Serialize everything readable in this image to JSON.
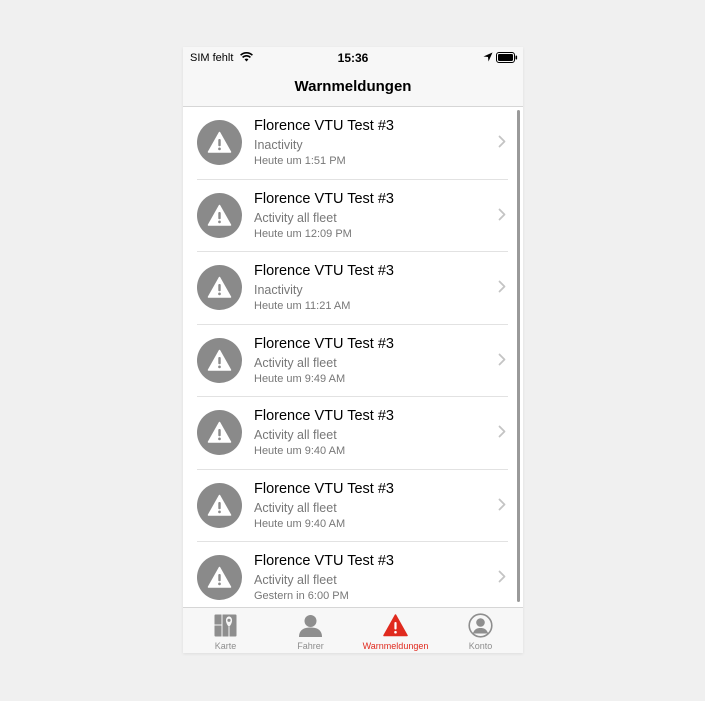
{
  "status": {
    "carrier": "SIM fehlt",
    "time": "15:36"
  },
  "nav": {
    "title": "Warnmeldungen"
  },
  "alerts": [
    {
      "title": "Florence VTU Test #3",
      "type": "Inactivity",
      "time": "Heute um 1:51 PM"
    },
    {
      "title": "Florence VTU Test #3",
      "type": "Activity all fleet",
      "time": "Heute um 12:09 PM"
    },
    {
      "title": "Florence VTU Test #3",
      "type": "Inactivity",
      "time": "Heute um 11:21 AM"
    },
    {
      "title": "Florence VTU Test #3",
      "type": "Activity all fleet",
      "time": "Heute um 9:49 AM"
    },
    {
      "title": "Florence VTU Test #3",
      "type": "Activity all fleet",
      "time": "Heute um 9:40 AM"
    },
    {
      "title": "Florence VTU Test #3",
      "type": "Activity all fleet",
      "time": "Heute um 9:40 AM"
    },
    {
      "title": "Florence VTU Test #3",
      "type": "Activity all fleet",
      "time": "Gestern in 6:00 PM"
    }
  ],
  "tabs": [
    {
      "label": "Karte",
      "icon": "map-icon"
    },
    {
      "label": "Fahrer",
      "icon": "driver-icon"
    },
    {
      "label": "Warnmeldungen",
      "icon": "warning-icon",
      "active": true
    },
    {
      "label": "Konto",
      "icon": "account-icon"
    }
  ],
  "colors": {
    "accent": "#e02a1e",
    "avatar": "#8a8a8a",
    "tab_inactive": "#8e8e8e"
  }
}
